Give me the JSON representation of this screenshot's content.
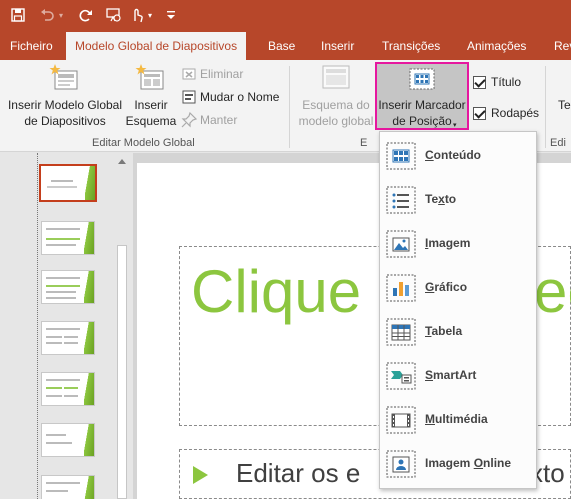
{
  "titlebar": {
    "qat": [
      "save-icon",
      "undo-icon",
      "redo-icon",
      "present-icon",
      "touch-mode-icon",
      "customize-icon"
    ]
  },
  "tabs": [
    {
      "label": "Ficheiro",
      "active": false
    },
    {
      "label": "Modelo Global de Diapositivos",
      "active": true
    },
    {
      "label": "Base",
      "active": false
    },
    {
      "label": "Inserir",
      "active": false
    },
    {
      "label": "Transições",
      "active": false
    },
    {
      "label": "Animações",
      "active": false
    },
    {
      "label": "Rev",
      "active": false
    }
  ],
  "ribbon": {
    "group1": {
      "label": "Editar Modelo Global",
      "insert_master": "Inserir Modelo Global\nde Diapositivos",
      "insert_layout": "Inserir\nEsquema",
      "delete": "Eliminar",
      "rename": "Mudar o Nome",
      "preserve": "Manter"
    },
    "group2": {
      "label": "E",
      "master_layout": "Esquema do\nmodelo global",
      "insert_placeholder": "Inserir Marcador\nde Posição",
      "title_check": "Título",
      "footers_check": "Rodapés"
    },
    "group3": {
      "label": "Edi",
      "partial_button": "Te"
    }
  },
  "slide": {
    "title_left": "Clique",
    "title_right": "ec",
    "body_left": "Editar os e",
    "body_right": "xto"
  },
  "dropdown": {
    "items": [
      {
        "pre": "",
        "ul": "C",
        "post": "onteúdo",
        "icon": "content-placeholder-icon"
      },
      {
        "pre": "Te",
        "ul": "x",
        "post": "to",
        "icon": "text-placeholder-icon"
      },
      {
        "pre": "",
        "ul": "I",
        "post": "magem",
        "icon": "picture-placeholder-icon"
      },
      {
        "pre": "",
        "ul": "G",
        "post": "ráfico",
        "icon": "chart-placeholder-icon"
      },
      {
        "pre": "",
        "ul": "T",
        "post": "abela",
        "icon": "table-placeholder-icon"
      },
      {
        "pre": "",
        "ul": "S",
        "post": "martArt",
        "icon": "smartart-placeholder-icon"
      },
      {
        "pre": "",
        "ul": "M",
        "post": "ultimédia",
        "icon": "media-placeholder-icon"
      },
      {
        "pre": "Imagem ",
        "ul": "O",
        "post": "nline",
        "icon": "online-image-placeholder-icon"
      }
    ]
  },
  "colors": {
    "accent": "#b7472a",
    "slide_green": "#8cc63f",
    "highlight": "#e6179f"
  }
}
